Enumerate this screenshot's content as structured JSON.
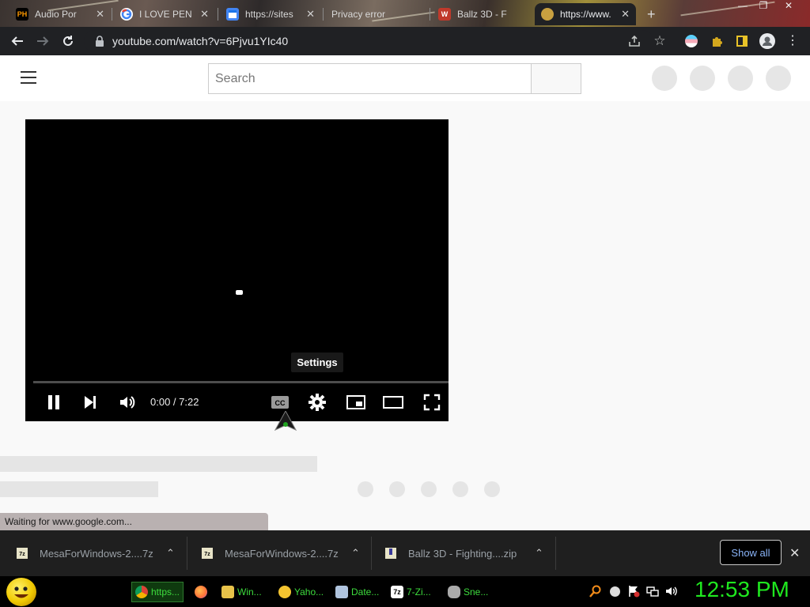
{
  "browser": {
    "tabs": [
      {
        "title": "Audio Por",
        "icon": "ph-icon",
        "color": "#ff9900"
      },
      {
        "title": "I LOVE PEN",
        "icon": "google-icon",
        "color": "#ffffff"
      },
      {
        "title": "https://sites",
        "icon": "sites-icon",
        "color": "#4285f4"
      },
      {
        "title": "Privacy error",
        "icon": "warning-icon",
        "color": "#cccccc"
      },
      {
        "title": "Ballz 3D - F",
        "icon": "ballz-icon",
        "color": "#c0392b"
      },
      {
        "title": "https://www.",
        "icon": "loading-icon",
        "color": "#c8a040"
      }
    ],
    "new_tab": "+",
    "url": "youtube.com/watch?v=6Pjvu1YIc40"
  },
  "youtube": {
    "search_placeholder": "Search",
    "player": {
      "tooltip": "Settings",
      "time": "0:00 / 7:22",
      "controls": [
        "pause-icon",
        "next-icon",
        "volume-icon",
        "cc-icon",
        "gear-icon",
        "miniplayer-icon",
        "theater-icon",
        "fullscreen-icon"
      ]
    }
  },
  "status": "Waiting for www.google.com...",
  "downloads": {
    "items": [
      {
        "name": "MesaForWindows-2....7z",
        "icon": "7z-file-icon"
      },
      {
        "name": "MesaForWindows-2....7z",
        "icon": "7z-file-icon"
      },
      {
        "name": "Ballz 3D - Fighting....zip",
        "icon": "zip-file-icon"
      }
    ],
    "show_all": "Show all"
  },
  "taskbar": {
    "buttons": [
      {
        "label": "https...",
        "icon": "chrome-icon",
        "color": "#4caf50"
      },
      {
        "label": "",
        "icon": "firefox-icon",
        "color": "#ff7139"
      },
      {
        "label": "Win...",
        "icon": "folder-icon",
        "color": "#e8c34a"
      },
      {
        "label": "Yaho...",
        "icon": "yahoo-icon",
        "color": "#f4c430"
      },
      {
        "label": "Date...",
        "icon": "date-icon",
        "color": "#b0c4de"
      },
      {
        "label": "7-Zi...",
        "icon": "7zip-icon",
        "color": "#ffffff"
      },
      {
        "label": "Sne...",
        "icon": "snes-icon",
        "color": "#aaaaaa"
      }
    ],
    "clock": "12:53 PM"
  },
  "colors": {
    "accent_link": "#8ab4f8",
    "taskbar_text": "#3ddc3d",
    "clock": "#1fe81f"
  }
}
